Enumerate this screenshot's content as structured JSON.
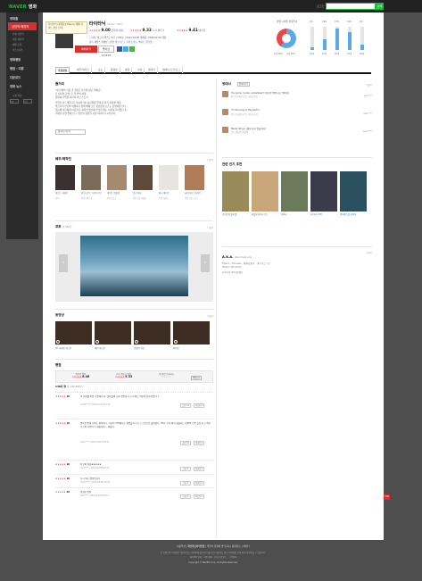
{
  "topbar": {
    "logo_brand": "NAVER",
    "logo_section": "영화",
    "link": "로그인",
    "search_button": "검색"
  },
  "sidebar": {
    "home": "영화홈",
    "active": "상영작·예정작",
    "sub": [
      "현재 상영작",
      "개봉 예정작",
      "예매 순위",
      "박스오피스"
    ],
    "items": [
      "영화랭킹",
      "평점 · 리뷰",
      "다운로드",
      "영화 뉴스"
    ],
    "settings": "시계 설정",
    "toggles": [
      "켜기",
      "끄기"
    ]
  },
  "header": {
    "tooltip": "타이타닉 (재개봉)(Titanic) 예매 사이트 정보 안내",
    "title": "타이타닉",
    "title_sub": "Titanic, 1997",
    "ratings": [
      {
        "label": "관람객 평점",
        "stars": "★★★★★",
        "value": "9.00"
      },
      {
        "label": "기자·평론가",
        "stars": "★★★★★",
        "value": "9.33"
      },
      {
        "label": "네티즌",
        "stars": "★★★★★",
        "value": "9.41"
      }
    ],
    "meta": "드라마, 멜로/로맨스 | 미국 | 194분 | 2012.04.05 재개봉, 1998.02.20 개봉",
    "meta2_label": "감독 제임스 카메론 | 출연",
    "meta2_cast": "레오나르도 디카프리오, 케이트 윈슬렛",
    "buttons": {
      "reserve": "예매하기",
      "like": "좋아요 12,870"
    }
  },
  "gender_chart": {
    "title": "성별·나이별 관람추이",
    "pie": [
      {
        "label": "여성 60%",
        "value": 60
      },
      {
        "label": "남성 40%",
        "value": 40
      }
    ],
    "bars": [
      {
        "label": "10대",
        "value": 4
      },
      {
        "label": "20대",
        "value": 19
      },
      {
        "label": "30대",
        "value": 37
      },
      {
        "label": "40대",
        "value": 31
      },
      {
        "label": "50대",
        "value": 9
      }
    ]
  },
  "tabs": [
    "주요정보",
    "배우/제작진",
    "포토",
    "동영상",
    "평점",
    "리뷰",
    "명대사",
    "예매/뉴스/블로그"
  ],
  "plot": {
    "heading": "줄거리",
    "lines": [
      "\"내 인생의 가장 큰 행운은 당신을 만난 거예요\"",
      "단 하나의 운명, 단 한 번의 사랑.",
      "영원히 기억될 세기의 러브 스토리",
      "우연한 카드게임으로 타이타닉호 승선권을 얻게 된 화가 지망생 잭과",
      "약혼자의 부모와 이별하기 위해 배에 오른 상류층의 로즈는 운명처럼 만나",
      "첫눈에 서로에게 이끌린다. 하지만 빙산에 부딪힌 배는 서서히 가라앉는데...",
      "거대한 운명 앞에 선 두 연인의 영원한 사랑 이야기가 시작된다."
    ],
    "button": "줄거리 더보기"
  },
  "cast": {
    "heading": "배우/제작진",
    "more": "더보기",
    "people": [
      {
        "name": "제임스 카메론",
        "role": "감독"
      },
      {
        "name": "레오나르도 디카프리오",
        "role": "주연 | 잭 도슨"
      },
      {
        "name": "케이트 윈슬렛",
        "role": "주연 | 로즈"
      },
      {
        "name": "빌리 제인",
        "role": "주연 | 칼 헉클리"
      },
      {
        "name": "캐시 베이츠",
        "role": "주연 | 몰리"
      },
      {
        "name": "글로리아 스튜어트",
        "role": "주연 | 올드 로즈"
      }
    ]
  },
  "photo": {
    "heading": "포토",
    "count": "총 942건",
    "more": "더보기"
  },
  "video": {
    "heading": "동영상",
    "more": "더보기",
    "items": [
      "3D 재개봉 예고편",
      "메인 예고편",
      "명장면 영상",
      "메이킹"
    ]
  },
  "rating": {
    "heading": "평점",
    "cells": [
      {
        "label": "관람객 평점",
        "stars": "★★★★★",
        "value": "8.46",
        "note": "참여 1,238명"
      },
      {
        "label": "기자·평론가 평점",
        "stars": "★★★★★",
        "value": "9.33",
        "note": "참여 3명"
      },
      {
        "label": "내 평점 등록하기",
        "stars": "★★★★★",
        "value": "",
        "note": ""
      }
    ],
    "button": "평점쓰기",
    "count_label": "140자 평",
    "count_value": "총 140,836건"
  },
  "comments": [
    {
      "stars": "★★★★★",
      "score": "10",
      "text": "이 영화를 처음 극장에서 본 것이 벌써 오래 전인데 다시 보아도 여전히 감동적입니다",
      "meta": "coldh**** | 2012.04.05 23:11",
      "good": "공감 43",
      "bad": "비공감 4"
    },
    {
      "stars": "★★★★★",
      "score": "10",
      "text": "명작은 언제 보아도 명작이다. 가슴이 먹먹해지는 장면들이 다시 스크린으로 돌아왔다. 3D로 보니 배가 침몰하는 장면이 더욱 실감 나고 잭과 로즈의 사랑이 더 애틋하게 느껴졌다.",
      "meta": "ruby**** | 2012.04.07 02:01",
      "good": "공감 16",
      "bad": "비공감 2"
    },
    {
      "stars": "★★★★★",
      "score": "10",
      "text": "최고의 영화★★★★★",
      "meta": "mint**** | 2012.04.08 10:24",
      "good": "공감 5",
      "bad": "비공감 1"
    },
    {
      "stars": "★★★★★",
      "score": "10",
      "text": "다시 봐도 명작입니다",
      "meta": "hyun**** | 2012.04.08 15:32",
      "good": "공감 3",
      "bad": "비공감 0"
    },
    {
      "stars": "★★★★★",
      "score": "10",
      "text": "영원한 명작",
      "meta": "star**** | 2012.04.09 09:12",
      "good": "공감 2",
      "bad": "비공감 0"
    }
  ],
  "best_lines": {
    "heading": "명대사",
    "badge": "명대사쓰기",
    "more": "더보기",
    "items": [
      {
        "text": "You jump, I jump, remember? (당신이 뛰면 나도 뛰어요)",
        "meta": "잭 도슨 (레오나르도 디카프리오)",
        "user": "rose****"
      },
      {
        "text": "I'm the king of the world!",
        "meta": "잭 도슨 (레오나르도 디카프리오)",
        "user": "titan****"
      },
      {
        "text": "Never let go. (절대 놓지 않을게요)",
        "meta": "로즈 (케이트 윈슬렛)",
        "user": "heart****"
      }
    ]
  },
  "related": {
    "heading": "관련 인기 추천",
    "items": [
      "로미오와 줄리엣",
      "레볼루셔너리 로드",
      "아바타",
      "타이타닉 3D",
      "네버랜드를 찾아서"
    ]
  },
  "aka": {
    "heading": "A.K.A.",
    "sub": "(Also Known As)",
    "lines": [
      "Titanic · Титаник · 泰坦尼克号 · タイタニック",
      "Titanic 3D (2012)",
      "타이타닉 3D (재개봉)"
    ],
    "more": "더보기"
  },
  "footer": {
    "links": [
      "이용약관",
      "개인정보처리방침",
      "책임의 한계와 법적고지",
      "회원정보 고객센터"
    ],
    "lines": [
      "본 콘텐츠의 저작권은 제공처 또는 네이버에 있으며 이를 무단 이용하는 경우 저작권법 등에 따라 처벌받을 수 있습니다.",
      "NAVER 영화 · 티켓 예매 · 영화 다운로드 · 고객센터"
    ],
    "copyright": "Copyright © NAVER Corp. All Rights Reserved."
  },
  "float_tag": "TOP"
}
